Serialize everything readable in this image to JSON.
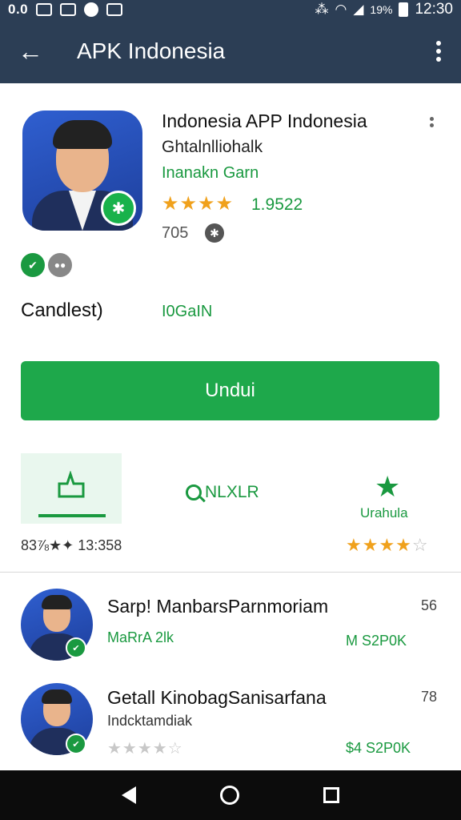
{
  "status_bar": {
    "left_text": "0.0",
    "battery_pct": "19%",
    "time": "12:30"
  },
  "app_bar": {
    "title": "APK Indonesia",
    "back_icon": "arrow-left-icon",
    "menu_icon": "more-vert-icon"
  },
  "app": {
    "name": "Indonesia APP Indonesia",
    "developer": "Ghtalnlliohalk",
    "category": "Inanakn Garn",
    "stars": "★★★★",
    "rating": "1.9522",
    "size": "705"
  },
  "details": {
    "left_label": "Candlest)",
    "right_label": "I0GaIN"
  },
  "download_button": "Undui",
  "tabs": {
    "search_label": "NLXLR",
    "star_label": "Urahula"
  },
  "stats": {
    "left": "83⅞★✦ 13:358",
    "right_stars": "★★★★",
    "right_star_empty": "☆"
  },
  "list": [
    {
      "title": "Sarp! ManbarsParnmoriam",
      "count": "56",
      "subtitle": "MaRrA 2lk",
      "price": "M S2P0K"
    },
    {
      "title": "Getall KinobagSanisarfana",
      "count": "78",
      "subtitle": "Indcktamdiak",
      "stars": "★★★★☆",
      "price": "$4 S2P0K"
    }
  ]
}
